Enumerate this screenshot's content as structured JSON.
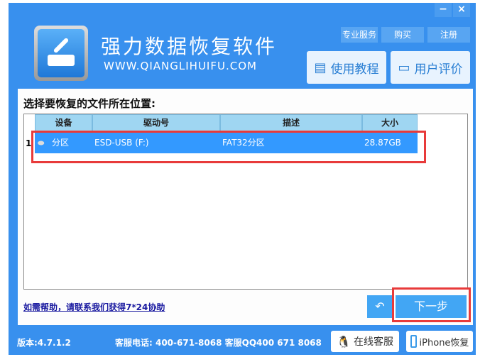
{
  "window": {
    "minimize": "−",
    "close": "×"
  },
  "header": {
    "title": "强力数据恢复软件",
    "url": "WWW.QIANGLIHUIFU.COM",
    "top_buttons": [
      "专业服务",
      "购买",
      "注册"
    ],
    "tutorial": "使用教程",
    "reviews": "用户评价"
  },
  "main": {
    "prompt": "选择要恢复的文件所在位置:",
    "columns": [
      "设备",
      "驱动号",
      "描述",
      "大小"
    ],
    "rows": [
      {
        "index": "1",
        "device": "分区",
        "drive": "ESD-USB (F:)",
        "desc": "FAT32分区",
        "size": "28.87GB"
      }
    ],
    "help_link": "如需帮助，请联系我们获得7*24协助",
    "next": "下一步"
  },
  "footer": {
    "version": "版本:4.7.1.2",
    "contact": "客服电话: 400-671-8068 客服QQ400 671 8068",
    "online": "在线客服",
    "iphone": "iPhone恢复"
  }
}
